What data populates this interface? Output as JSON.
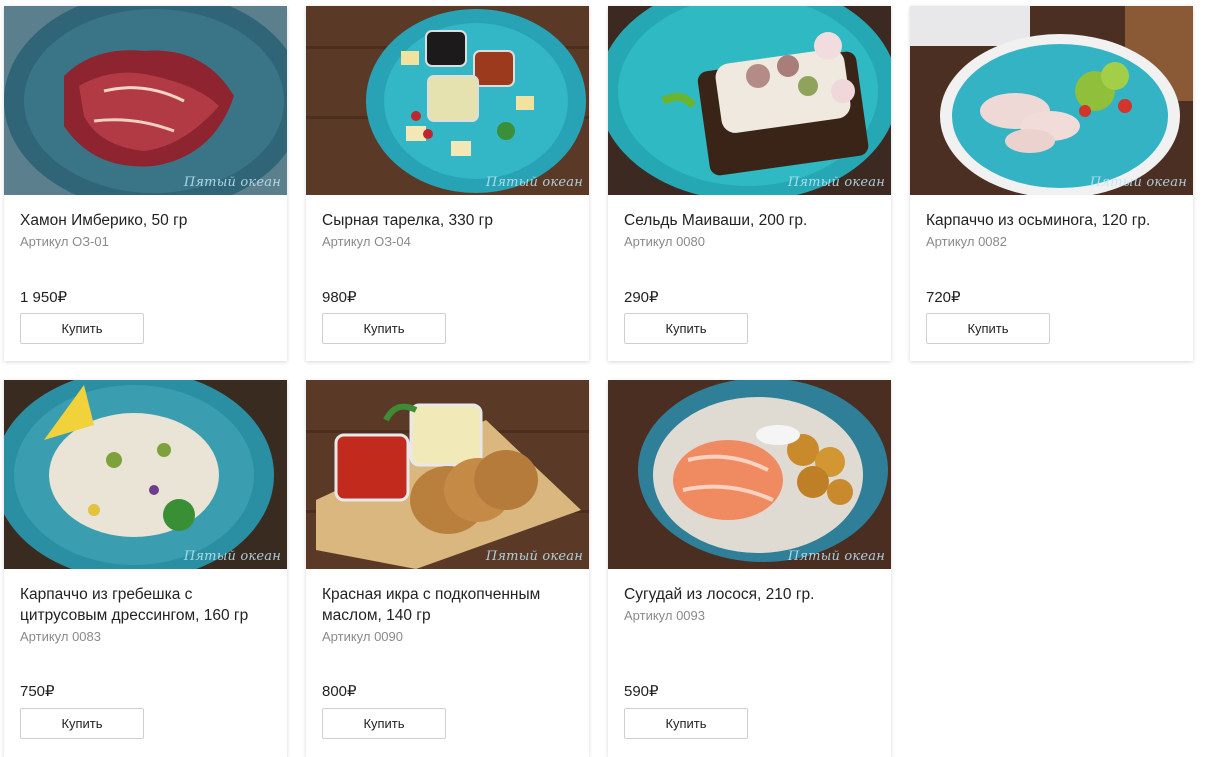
{
  "watermark": "Пятый океан",
  "buy_label": "Купить",
  "products": [
    {
      "title": "Хамон Имберико, 50 гр",
      "sku": "Артикул ОЗ-01",
      "price": "1 950₽"
    },
    {
      "title": "Сырная тарелка, 330 гр",
      "sku": "Артикул ОЗ-04",
      "price": "980₽"
    },
    {
      "title": "Сельдь Маиваши, 200 гр.",
      "sku": "Артикул 0080",
      "price": "290₽"
    },
    {
      "title": "Карпаччо из осьминога, 120 гр.",
      "sku": "Артикул 0082",
      "price": "720₽"
    },
    {
      "title": "Карпаччо из гребешка с цитрусовым дрессингом, 160 гр",
      "sku": "Артикул 0083",
      "price": "750₽"
    },
    {
      "title": "Красная икра с подкопченным маслом, 140 гр",
      "sku": "Артикул 0090",
      "price": "800₽"
    },
    {
      "title": "Сугудай из лосося, 210 гр.",
      "sku": "Артикул 0093",
      "price": "590₽"
    }
  ]
}
